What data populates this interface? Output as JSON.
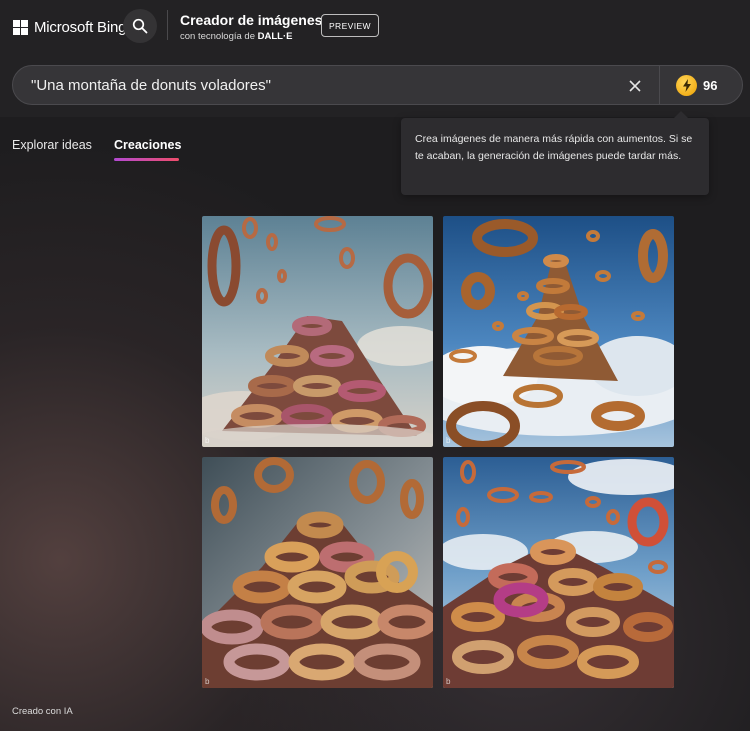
{
  "header": {
    "brand": "Microsoft Bing",
    "title": "Creador de imágenes",
    "subtitle_prefix": "con tecnología de ",
    "subtitle_strong": "DALL·E",
    "preview_label": "PREVIEW"
  },
  "search": {
    "query": "\"Una montaña de donuts voladores\""
  },
  "boosts": {
    "count": "96"
  },
  "tooltip": {
    "text": "Crea imágenes de manera más rápida con aumentos. Si se te acaban, la generación de imágenes puede tardar más."
  },
  "tabs": [
    {
      "label": "Explorar ideas"
    },
    {
      "label": "Creaciones"
    }
  ],
  "images": [
    {
      "icon": "donut-mountain-image"
    },
    {
      "icon": "donut-mountain-image"
    },
    {
      "icon": "donut-mountain-image"
    },
    {
      "icon": "donut-mountain-image"
    }
  ],
  "footer": {
    "label": "Creado con IA"
  },
  "colors": {
    "accent_gradient_start": "#b34ad2",
    "accent_gradient_end": "#ef4d6b",
    "boost_coin": "#f2b01b",
    "background": "#1e1d1f"
  }
}
